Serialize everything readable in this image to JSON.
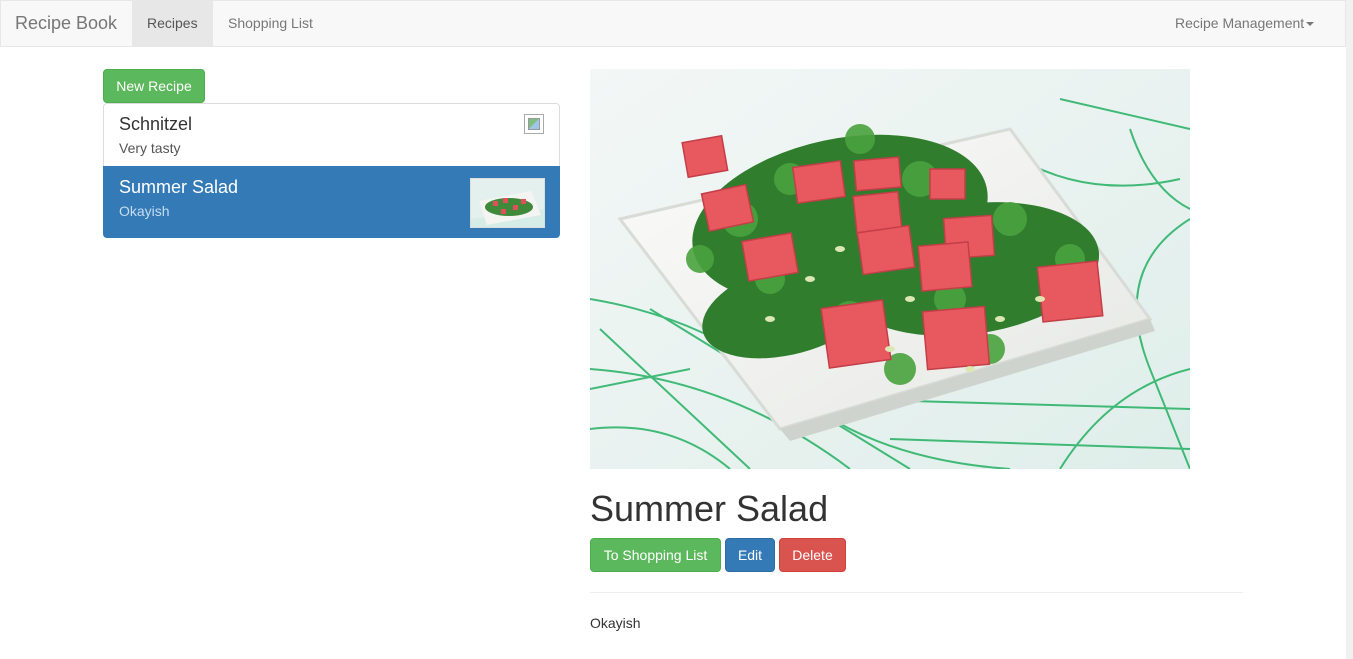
{
  "navbar": {
    "brand": "Recipe Book",
    "links": [
      {
        "label": "Recipes",
        "active": true
      },
      {
        "label": "Shopping List",
        "active": false
      }
    ],
    "dropdown_label": "Recipe Management"
  },
  "sidebar": {
    "new_button_label": "New Recipe",
    "recipes": [
      {
        "title": "Schnitzel",
        "description": "Very tasty",
        "image": "broken-image-icon",
        "selected": false
      },
      {
        "title": "Summer Salad",
        "description": "Okayish",
        "image": "salad-thumbnail",
        "selected": true
      }
    ]
  },
  "detail": {
    "image": "summer-salad-photo",
    "title": "Summer Salad",
    "buttons": {
      "shopping": "To Shopping List",
      "edit": "Edit",
      "delete": "Delete"
    },
    "description": "Okayish"
  },
  "colors": {
    "success": "#5cb85c",
    "primary": "#337ab7",
    "danger": "#d9534f",
    "navbar_bg": "#f8f8f8"
  }
}
